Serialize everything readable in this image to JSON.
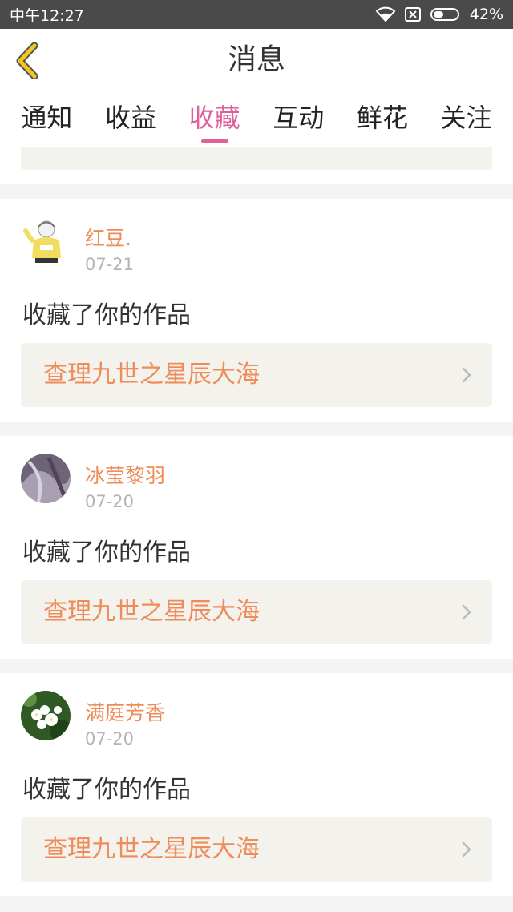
{
  "status_bar": {
    "carrier_time": "中午12:27",
    "battery": "42%"
  },
  "header": {
    "title": "消息"
  },
  "tabs": [
    {
      "label": "通知"
    },
    {
      "label": "收益"
    },
    {
      "label": "收藏",
      "active": true
    },
    {
      "label": "互动"
    },
    {
      "label": "鲜花"
    },
    {
      "label": "关注"
    }
  ],
  "items": [
    {
      "name": "红豆.",
      "date": "07-21",
      "action": "收藏了你的作品",
      "work": "查理九世之星辰大海",
      "avatar_icon": "cartoon-avatar-icon"
    },
    {
      "name": "冰莹黎羽",
      "date": "07-20",
      "action": "收藏了你的作品",
      "work": "查理九世之星辰大海",
      "avatar_icon": "photo-avatar-icon"
    },
    {
      "name": "满庭芳香",
      "date": "07-20",
      "action": "收藏了你的作品",
      "work": "查理九世之星辰大海",
      "avatar_icon": "flower-avatar-icon"
    }
  ],
  "colors": {
    "accent_pink": "#e0609a",
    "name_orange": "#ee8c5a",
    "back_yellow": "#f2c81c"
  }
}
